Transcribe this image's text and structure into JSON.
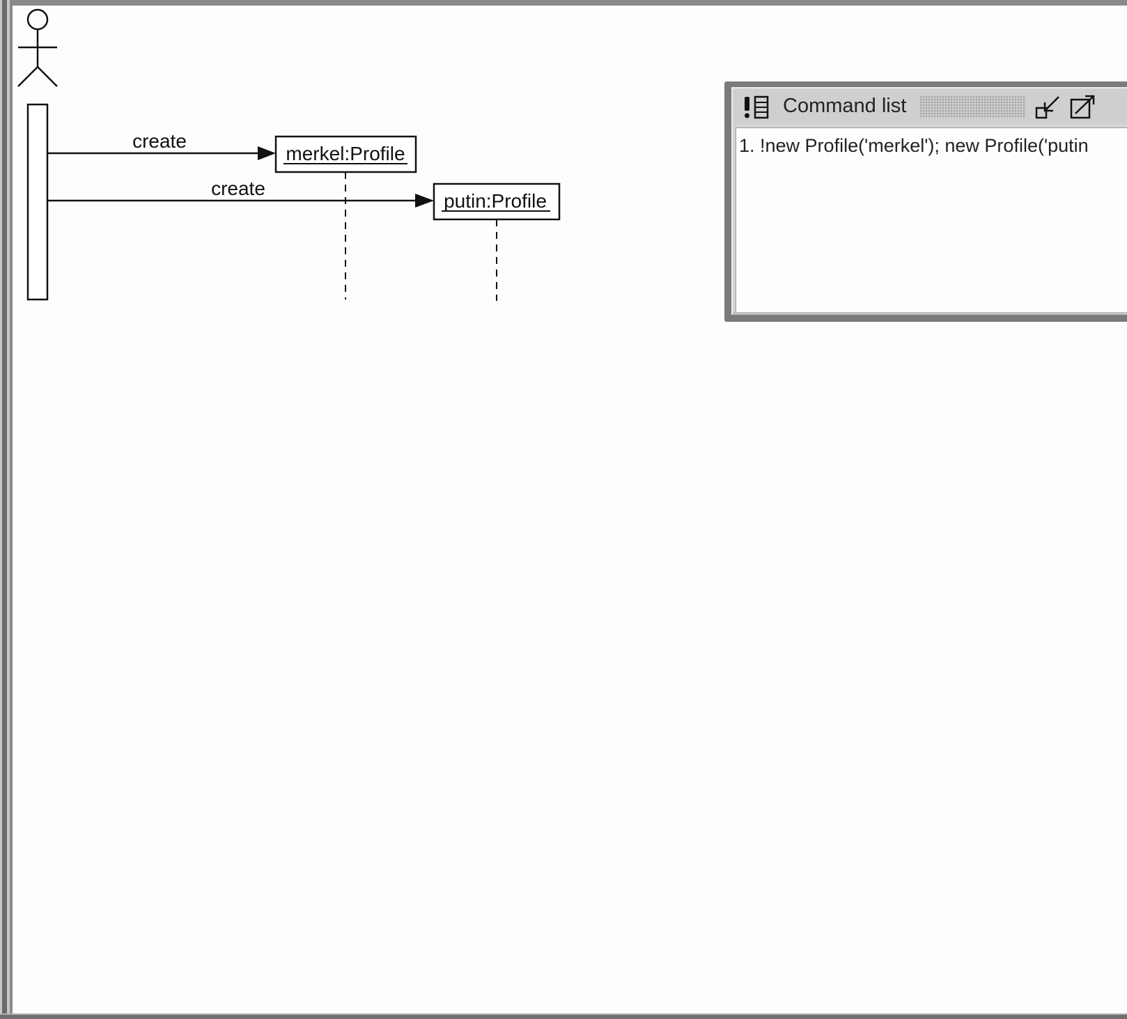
{
  "diagram": {
    "messages": [
      {
        "label": "create"
      },
      {
        "label": "create"
      }
    ],
    "objects": [
      {
        "label": "merkel:Profile"
      },
      {
        "label": "putin:Profile"
      }
    ]
  },
  "command_window": {
    "title": "Command list",
    "icons": {
      "app": "command-list-icon",
      "iconify": "iconify-icon",
      "maximize": "maximize-icon"
    },
    "entries": [
      "1. !new Profile('merkel'); new Profile('putin"
    ]
  }
}
